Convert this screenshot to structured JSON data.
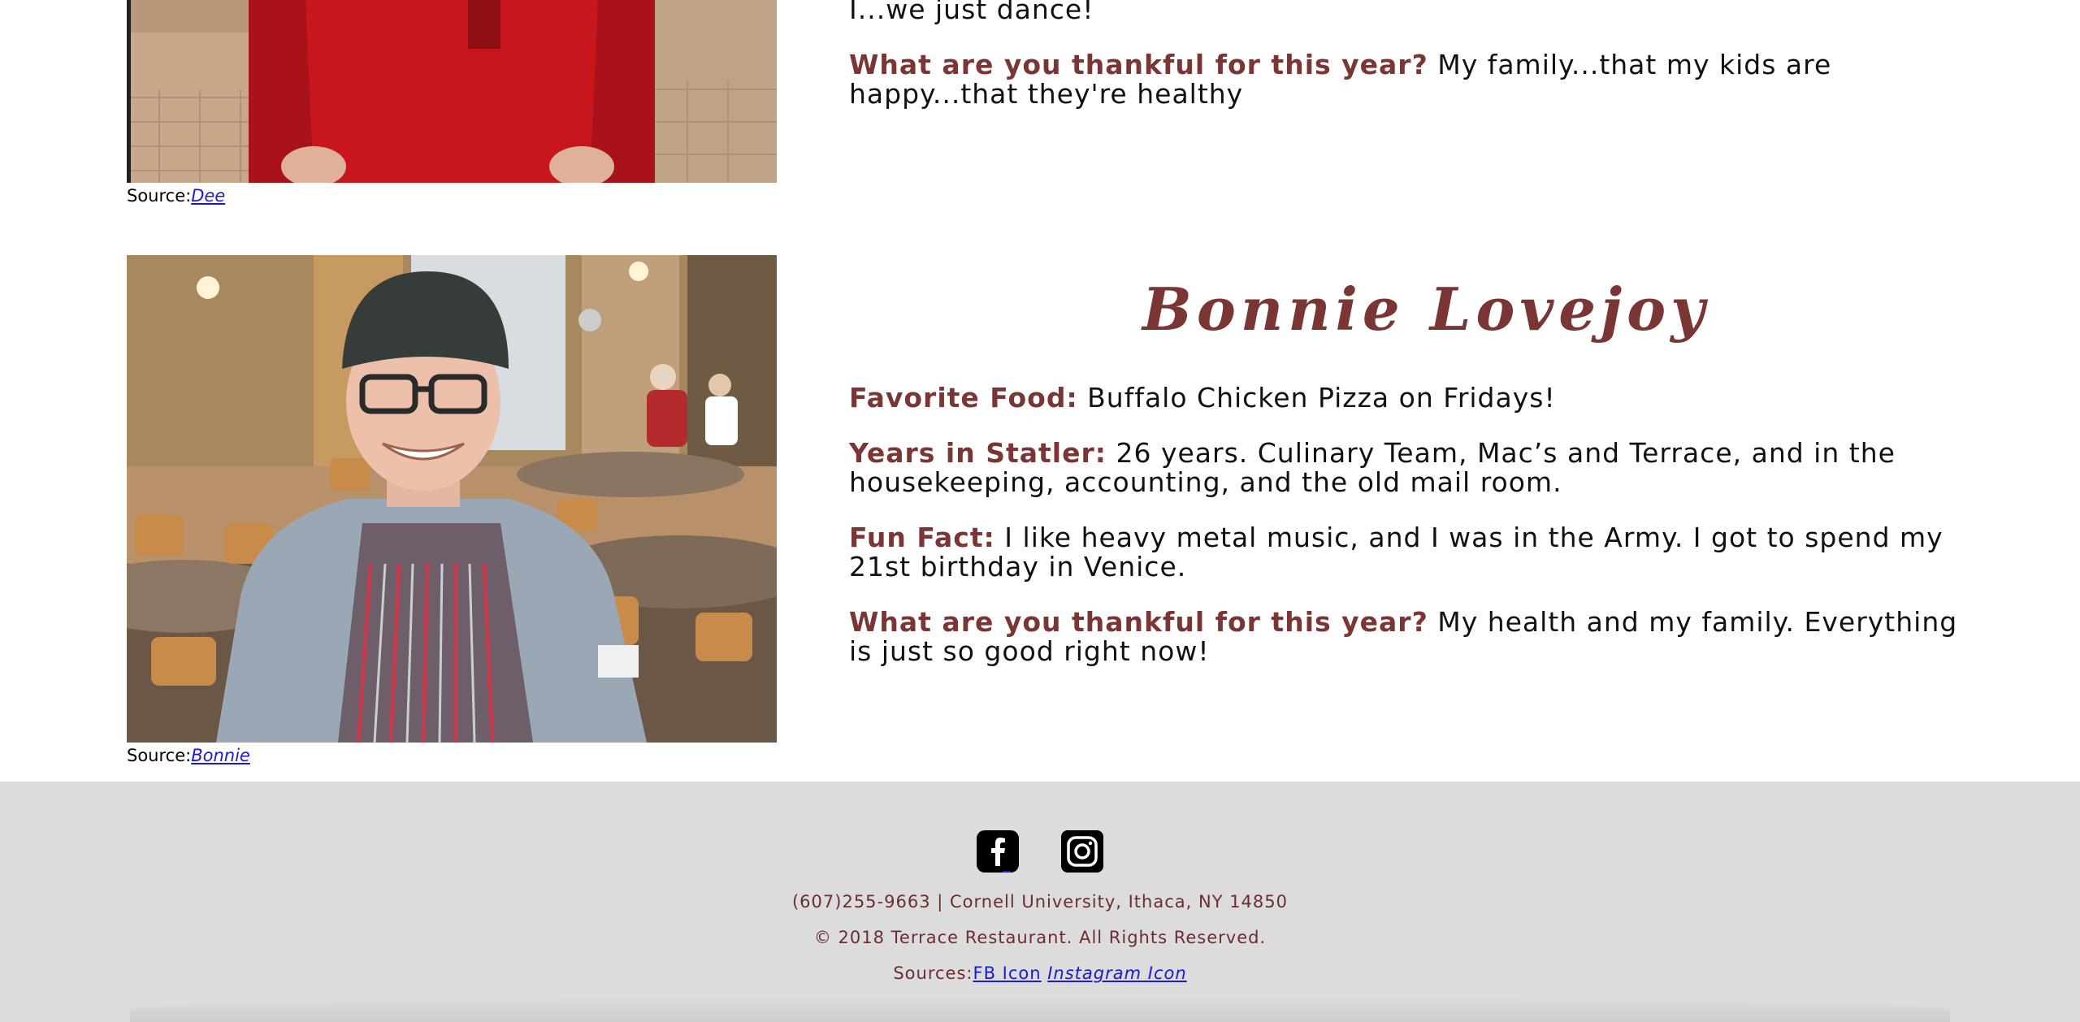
{
  "dee": {
    "fun_fact_tail": "I...we just dance!",
    "thankful_label": "What are you thankful for this year?",
    "thankful_value": "My family...that my kids are happy...that they're healthy",
    "source_label": "Source:",
    "source_link": "Dee"
  },
  "bonnie": {
    "name": "Bonnie Lovejoy",
    "favorite_food_label": "Favorite Food:",
    "favorite_food_value": "Buffalo Chicken Pizza on Fridays!",
    "years_label": "Years in Statler:",
    "years_value": "26 years. Culinary Team, Mac’s and Terrace, and in the housekeeping, accounting, and the old mail room.",
    "fun_fact_label": "Fun Fact:",
    "fun_fact_value": "I like heavy metal music, and I was in the Army. I got to spend my 21st birthday in Venice.",
    "thankful_label": "What are you thankful for this year?",
    "thankful_value": "My health and my family. Everything is just so good right now!",
    "source_label": "Source:",
    "source_link": "Bonnie"
  },
  "footer": {
    "icons": [
      "facebook-icon",
      "instagram-icon"
    ],
    "contact": "(607)255-9663 | Cornell University, Ithaca, NY 14850",
    "copyright": "© 2018 Terrace Restaurant. All Rights Reserved.",
    "sources_label": "Sources:",
    "fb_icon_link": "FB Icon",
    "instagram_icon_link": "Instagram Icon"
  },
  "colors": {
    "accent": "#7a3535",
    "footer_bg": "#dcdcdc",
    "link": "#1a1ad4"
  }
}
